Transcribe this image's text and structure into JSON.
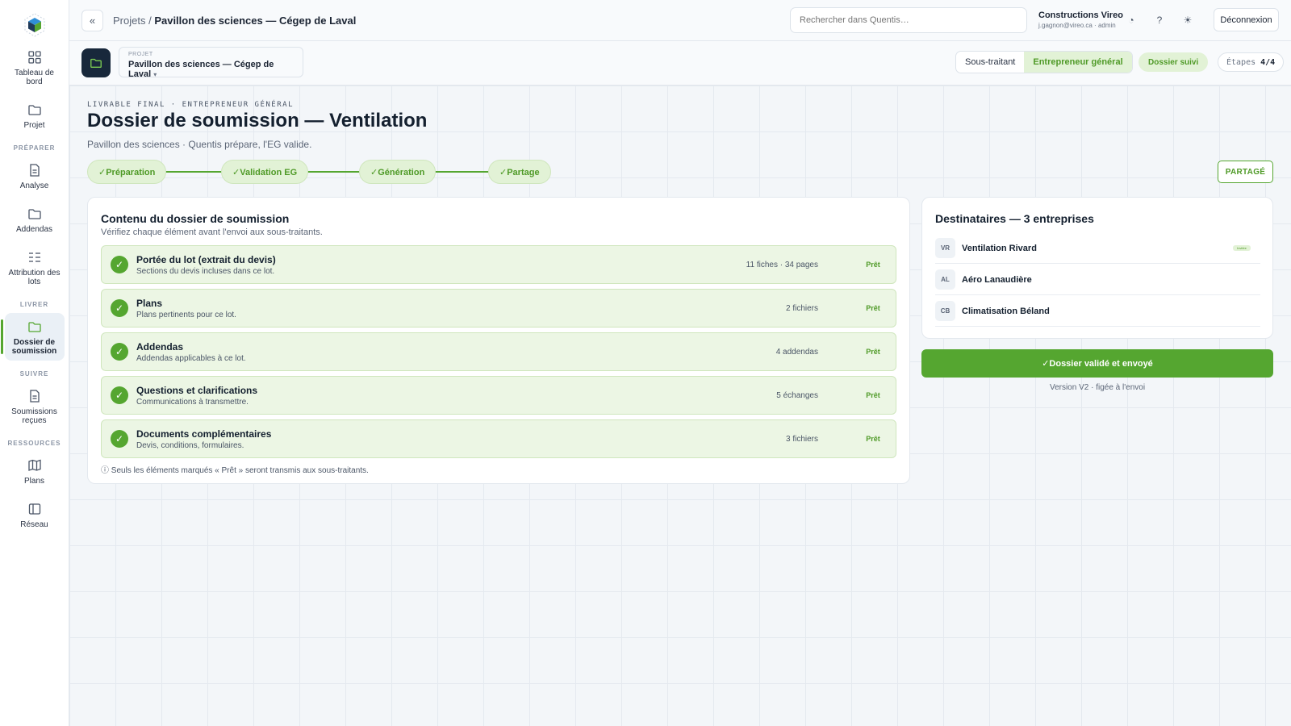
{
  "topbar": {
    "collapse_label": "«",
    "breadcrumb_root": "Projets /",
    "breadcrumb_current": "Pavillon des sciences — Cégep de Laval",
    "search_placeholder": "Rechercher dans Quentis…",
    "user_company": "Constructions Vireo",
    "user_meta": "j.gagnon@vireo.ca · admin",
    "history_icon": "◔",
    "help_icon": "?",
    "theme_icon": "☀",
    "logout_label": "Déconnexion"
  },
  "sidebar": {
    "items_top": [
      {
        "label": "Tableau de bord",
        "icon": "grid-icon"
      },
      {
        "label": "Projet",
        "icon": "folder-icon"
      }
    ],
    "section_preparer": "PRÉPARER",
    "items_preparer": [
      {
        "label": "Analyse",
        "icon": "document-icon"
      },
      {
        "label": "Addendas",
        "icon": "folder-icon"
      },
      {
        "label": "Attribution des lots",
        "icon": "list-icon"
      }
    ],
    "section_livrer": "LIVRER",
    "item_livrer": {
      "label": "Dossier de soumission",
      "icon": "folder-icon"
    },
    "section_suivre": "SUIVRE",
    "item_suivre": {
      "label": "Soumissions reçues",
      "icon": "document-icon"
    },
    "section_ressources": "RESSOURCES",
    "items_ressources": [
      {
        "label": "Plans",
        "icon": "map-icon"
      },
      {
        "label": "Réseau",
        "icon": "panel-icon"
      }
    ]
  },
  "projbar": {
    "select_key": "PROJET",
    "select_value": "Pavillon des sciences — Cégep de Laval",
    "select_caret": "▾",
    "role_off": "Sous-traitant",
    "role_on": "Entrepreneur général",
    "status_badge": "Dossier suivi",
    "steps_label": "Étapes",
    "steps_value": "4/4"
  },
  "main": {
    "eyebrow": "LIVRABLE FINAL · ENTREPRENEUR GÉNÉRAL",
    "title": "Dossier de soumission — Ventilation",
    "subtitle": "Pavillon des sciences · Quentis prépare, l'EG valide.",
    "steps": [
      "✓Préparation",
      "✓Validation EG",
      "✓Génération",
      "✓Partage"
    ],
    "share_status": "PARTAGÉ"
  },
  "content": {
    "title": "Contenu du dossier de soumission",
    "description": "Vérifiez chaque élément avant l'envoi aux sous-traitants.",
    "items": [
      {
        "title": "Portée du lot (extrait du devis)",
        "sub": "Sections du devis incluses dans ce lot.",
        "meta": "11 fiches · 34 pages",
        "status": "Prêt"
      },
      {
        "title": "Plans",
        "sub": "Plans pertinents pour ce lot.",
        "meta": "2 fichiers",
        "status": "Prêt"
      },
      {
        "title": "Addendas",
        "sub": "Addendas applicables à ce lot.",
        "meta": "4 addendas",
        "status": "Prêt"
      },
      {
        "title": "Questions et clarifications",
        "sub": "Communications à transmettre.",
        "meta": "5 échanges",
        "status": "Prêt"
      },
      {
        "title": "Documents complémentaires",
        "sub": "Devis, conditions, formulaires.",
        "meta": "3 fichiers",
        "status": "Prêt"
      }
    ],
    "check_glyph": "✓",
    "footnote": "ⓘ Seuls les éléments marqués « Prêt » seront transmis aux sous-traitants."
  },
  "recipients": {
    "title": "Destinataires — 3 entreprises",
    "list": [
      {
        "initials": "VR",
        "name": "Ventilation Rivard",
        "tag": "Invitée"
      },
      {
        "initials": "AL",
        "name": "Aéro Lanaudière",
        "tag": ""
      },
      {
        "initials": "CB",
        "name": "Climatisation Béland",
        "tag": ""
      }
    ],
    "send_button": "✓Dossier validé et envoyé",
    "version_note": "Version V2 · figée à l'envoi"
  }
}
